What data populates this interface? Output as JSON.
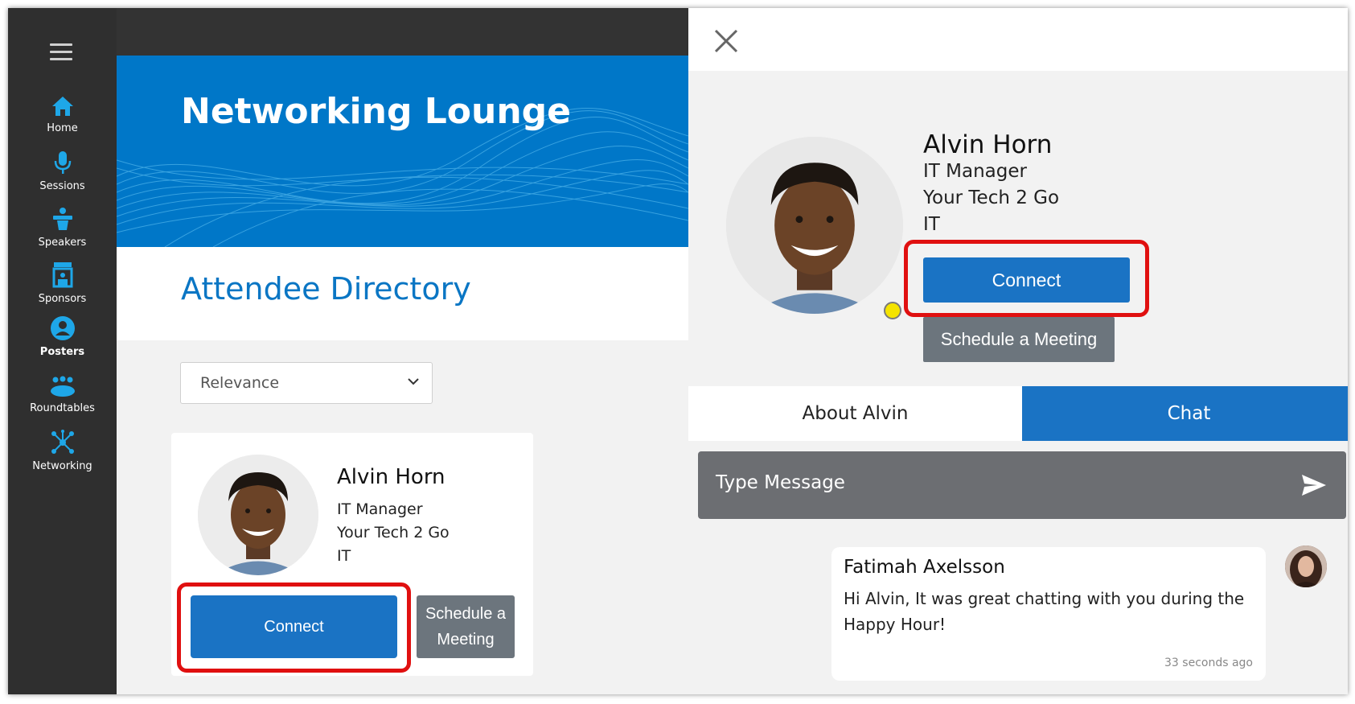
{
  "sidebar": {
    "items": [
      {
        "label": "Home",
        "icon": "home-icon"
      },
      {
        "label": "Sessions",
        "icon": "microphone-icon"
      },
      {
        "label": "Speakers",
        "icon": "podium-icon"
      },
      {
        "label": "Sponsors",
        "icon": "booth-icon"
      },
      {
        "label": "Posters",
        "icon": "user-circle-icon"
      },
      {
        "label": "Roundtables",
        "icon": "group-icon"
      },
      {
        "label": "Networking",
        "icon": "network-icon"
      }
    ],
    "active": "Posters",
    "icon_color": "#1ea7e8"
  },
  "banner": {
    "title": "Networking Lounge"
  },
  "directory": {
    "title": "Attendee Directory",
    "sort_value": "Relevance"
  },
  "card": {
    "name": "Alvin Horn",
    "title": "IT Manager",
    "company": "Your Tech 2 Go",
    "dept": "IT",
    "connect_label": "Connect",
    "schedule_label": "Schedule a Meeting"
  },
  "panel": {
    "name": "Alvin Horn",
    "title": "IT Manager",
    "company": "Your Tech 2 Go",
    "dept": "IT",
    "connect_label": "Connect",
    "schedule_label": "Schedule a Meeting",
    "tabs": [
      {
        "label": "About Alvin",
        "active": false
      },
      {
        "label": "Chat",
        "active": true
      }
    ],
    "message_placeholder": "Type Message",
    "messages": [
      {
        "author": "Fatimah Axelsson",
        "text": "Hi Alvin, It was great chatting with you during the Happy Hour!",
        "time": "33 seconds ago"
      }
    ]
  },
  "colors": {
    "brand_blue": "#1a73c4",
    "highlight_red": "#e01010",
    "status_yellow": "#f5e400"
  }
}
